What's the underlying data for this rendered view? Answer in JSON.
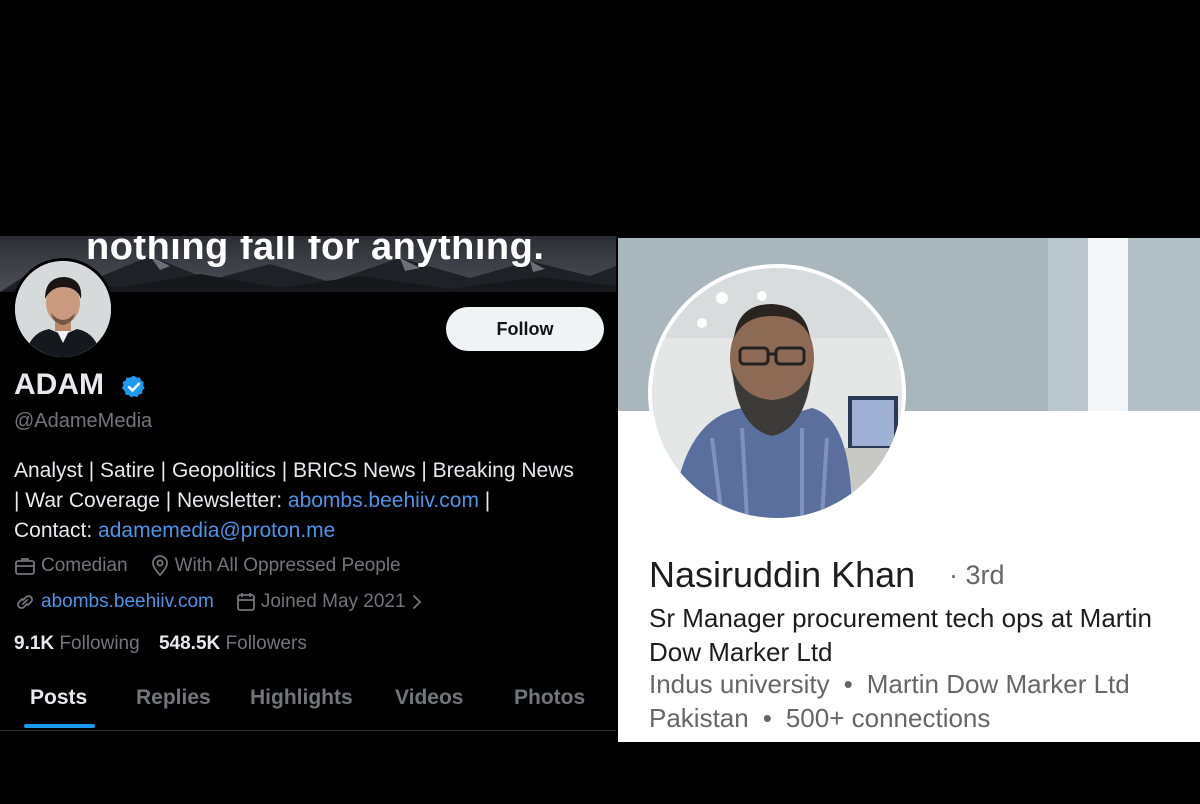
{
  "twitter": {
    "banner_text": "nothing fall for anything.",
    "follow_label": "Follow",
    "name": "ADAM",
    "handle": "@AdameMedia",
    "bio_line1": "Analyst | Satire | Geopolitics | BRICS News | Breaking News",
    "bio_line2_prefix": "| War Coverage | Newsletter: ",
    "bio_link": "abombs.beehiiv.com",
    "bio_line2_suffix": " |",
    "bio_line3_prefix": "Contact: ",
    "bio_email": "adamemedia@proton.me",
    "profession": "Comedian",
    "location": "With All Oppressed People",
    "website": "abombs.beehiiv.com",
    "joined": "Joined May 2021",
    "following_count": "9.1K",
    "following_label": "Following",
    "followers_count": "548.5K",
    "followers_label": "Followers",
    "tabs": [
      "Posts",
      "Replies",
      "Highlights",
      "Videos",
      "Photos"
    ],
    "colors": {
      "link": "#4a95e8",
      "verified": "#1d9bf0",
      "text": "#e7e9ea",
      "muted": "#71767b"
    }
  },
  "linkedin": {
    "name": "Nasiruddin Khan",
    "degree": "· 3rd",
    "headline": "Sr Manager procurement tech ops at Martin Dow Marker Ltd",
    "education": "Indus university",
    "company": "Martin Dow Marker Ltd",
    "location": "Pakistan",
    "connections": "500+ connections",
    "separator": "•"
  }
}
